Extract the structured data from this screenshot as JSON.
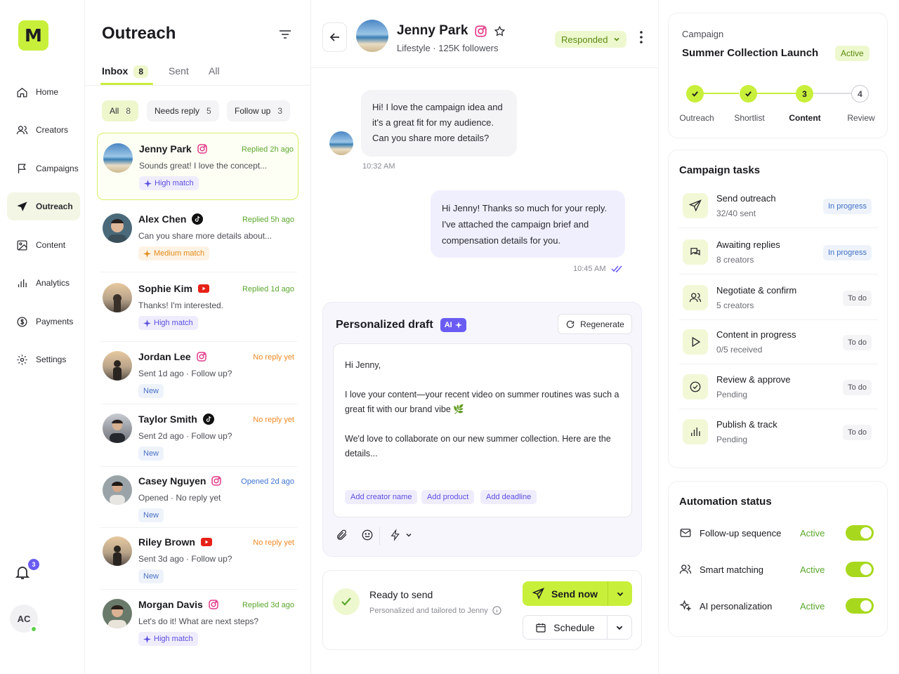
{
  "nav": {
    "logo": "M",
    "items": [
      {
        "label": "Home",
        "icon": "home-icon"
      },
      {
        "label": "Creators",
        "icon": "users-icon"
      },
      {
        "label": "Campaigns",
        "icon": "flag-icon"
      },
      {
        "label": "Outreach",
        "icon": "send-icon",
        "active": true
      },
      {
        "label": "Content",
        "icon": "image-icon"
      },
      {
        "label": "Analytics",
        "icon": "bar-chart-icon"
      },
      {
        "label": "Payments",
        "icon": "dollar-icon"
      },
      {
        "label": "Settings",
        "icon": "gear-icon"
      }
    ],
    "notifications": "3",
    "user_initials": "AC"
  },
  "inbox": {
    "title": "Outreach",
    "tabs": [
      {
        "label": "Inbox",
        "count": "8"
      },
      {
        "label": "Sent"
      },
      {
        "label": "All"
      }
    ],
    "chips": [
      {
        "label": "All",
        "count": "8"
      },
      {
        "label": "Needs reply",
        "count": "5"
      },
      {
        "label": "Follow up",
        "count": "3"
      }
    ],
    "conversations": [
      {
        "name": "Jenny Park",
        "platform": "instagram",
        "status": "Replied 2h ago",
        "preview": "Sounds great! I love the concept...",
        "badge": "High match"
      },
      {
        "name": "Alex Chen",
        "platform": "tiktok",
        "status": "Replied 5h ago",
        "preview": "Can you share more details about...",
        "badge": "Medium match"
      },
      {
        "name": "Sophie Kim",
        "platform": "youtube",
        "status": "Replied 1d ago",
        "preview": "Thanks! I'm interested.",
        "badge": "High match"
      },
      {
        "name": "Jordan Lee",
        "platform": "instagram",
        "status": "No reply yet",
        "preview": "Sent 1d ago · Follow up?",
        "badge": "New"
      },
      {
        "name": "Taylor Smith",
        "platform": "tiktok",
        "status": "No reply yet",
        "preview": "Sent 2d ago · Follow up?",
        "badge": "New"
      },
      {
        "name": "Casey Nguyen",
        "platform": "instagram",
        "status": "Opened 2d ago",
        "preview": "Opened · No reply yet",
        "badge": "New"
      },
      {
        "name": "Riley Brown",
        "platform": "youtube",
        "status": "No reply yet",
        "preview": "Sent 3d ago · Follow up?",
        "badge": "New"
      },
      {
        "name": "Morgan Davis",
        "platform": "instagram",
        "status": "Replied 3d ago",
        "preview": "Let's do it! What are next steps?",
        "badge": "High match"
      }
    ]
  },
  "chat": {
    "name": "Jenny Park",
    "subtitle": "Lifestyle · 125K followers",
    "status": "Responded",
    "messages": [
      {
        "from": "creator",
        "text": "Hi! I love the campaign idea and it's a great fit for my audience. Can you share more details?",
        "time": "10:32 AM"
      },
      {
        "from": "me",
        "text": "Hi Jenny! Thanks so much for your reply. I've attached the campaign brief and compensation details for you.",
        "time": "10:45 AM"
      }
    ],
    "draft": {
      "title": "Personalized draft",
      "ai_label": "AI",
      "regenerate": "Regenerate",
      "greeting": "Hi Jenny,",
      "para1": "I love your content—your recent video on summer routines was such a great fit with our brand vibe 🌿",
      "para2": "We'd love to collaborate on our new summer collection. Here are the details...",
      "placeholders": [
        "Add creator name",
        "Add product",
        "Add deadline"
      ]
    },
    "ready": {
      "title": "Ready to send",
      "subtitle": "Personalized and tailored to Jenny",
      "send": "Send now",
      "schedule": "Schedule"
    }
  },
  "campaign": {
    "label": "Campaign",
    "name": "Summer Collection Launch",
    "status": "Active",
    "steps": [
      {
        "label": "Outreach",
        "state": "done"
      },
      {
        "label": "Shortlist",
        "state": "done"
      },
      {
        "label": "Content",
        "state": "current",
        "num": "3"
      },
      {
        "label": "Review",
        "state": "todo",
        "num": "4"
      }
    ]
  },
  "tasks": {
    "title": "Campaign tasks",
    "items": [
      {
        "title": "Send outreach",
        "sub": "32/40 sent",
        "status": "In progress",
        "icon": "send-icon"
      },
      {
        "title": "Awaiting replies",
        "sub": "8 creators",
        "status": "In progress",
        "icon": "chat-icon"
      },
      {
        "title": "Negotiate & confirm",
        "sub": "5 creators",
        "status": "To do",
        "icon": "users-icon"
      },
      {
        "title": "Content in progress",
        "sub": "0/5 received",
        "status": "To do",
        "icon": "play-icon"
      },
      {
        "title": "Review & approve",
        "sub": "Pending",
        "status": "To do",
        "icon": "check-circle-icon"
      },
      {
        "title": "Publish & track",
        "sub": "Pending",
        "status": "To do",
        "icon": "bar-chart-icon"
      }
    ]
  },
  "automation": {
    "title": "Automation status",
    "items": [
      {
        "label": "Follow-up sequence",
        "status": "Active",
        "icon": "mail-icon"
      },
      {
        "label": "Smart matching",
        "status": "Active",
        "icon": "users-icon"
      },
      {
        "label": "AI personalization",
        "status": "Active",
        "icon": "sparkle-icon"
      }
    ]
  },
  "colors": {
    "accent": "#c8ef3a",
    "ai": "#6a5cf2",
    "green_text": "#5aa72c"
  }
}
